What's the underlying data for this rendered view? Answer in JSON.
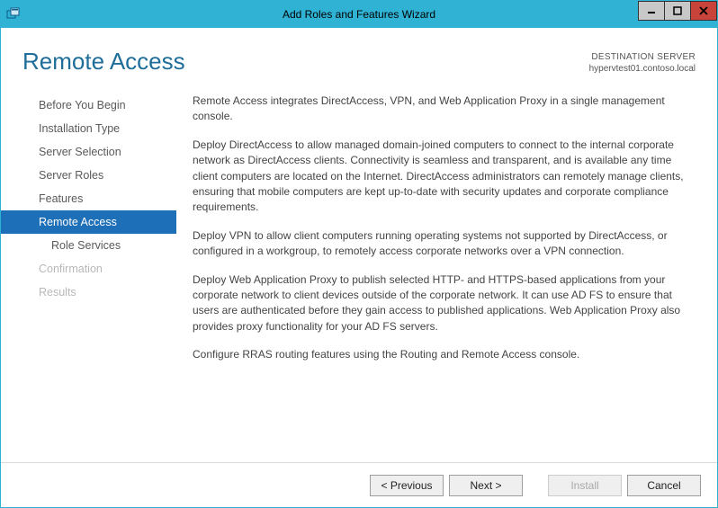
{
  "window": {
    "title": "Add Roles and Features Wizard"
  },
  "header": {
    "page_title": "Remote Access",
    "dest_label": "DESTINATION SERVER",
    "dest_value": "hypervtest01.contoso.local"
  },
  "sidebar": {
    "items": [
      {
        "label": "Before You Begin",
        "state": "normal"
      },
      {
        "label": "Installation Type",
        "state": "normal"
      },
      {
        "label": "Server Selection",
        "state": "normal"
      },
      {
        "label": "Server Roles",
        "state": "normal"
      },
      {
        "label": "Features",
        "state": "normal"
      },
      {
        "label": "Remote Access",
        "state": "active"
      },
      {
        "label": "Role Services",
        "state": "normal",
        "sub": true
      },
      {
        "label": "Confirmation",
        "state": "disabled"
      },
      {
        "label": "Results",
        "state": "disabled"
      }
    ]
  },
  "body": {
    "p1": "Remote Access integrates DirectAccess, VPN, and Web Application Proxy in a single management console.",
    "p2": "Deploy DirectAccess to allow managed domain-joined computers to connect to the internal corporate network as DirectAccess clients. Connectivity is seamless and transparent, and is available any time client computers are located on the Internet. DirectAccess administrators can remotely manage clients, ensuring that mobile computers are kept up-to-date with security updates and corporate compliance requirements.",
    "p3": "Deploy VPN to allow client computers running operating systems not supported by DirectAccess, or configured in a workgroup, to remotely access corporate networks over a VPN connection.",
    "p4": "Deploy Web Application Proxy to publish selected HTTP- and HTTPS-based applications from your corporate network to client devices outside of the corporate network. It can use AD FS to ensure that users are authenticated before they gain access to published applications. Web Application Proxy also provides proxy functionality for your AD FS servers.",
    "p5": "Configure RRAS routing features using the Routing and Remote Access console."
  },
  "footer": {
    "previous": "< Previous",
    "next": "Next >",
    "install": "Install",
    "cancel": "Cancel"
  }
}
